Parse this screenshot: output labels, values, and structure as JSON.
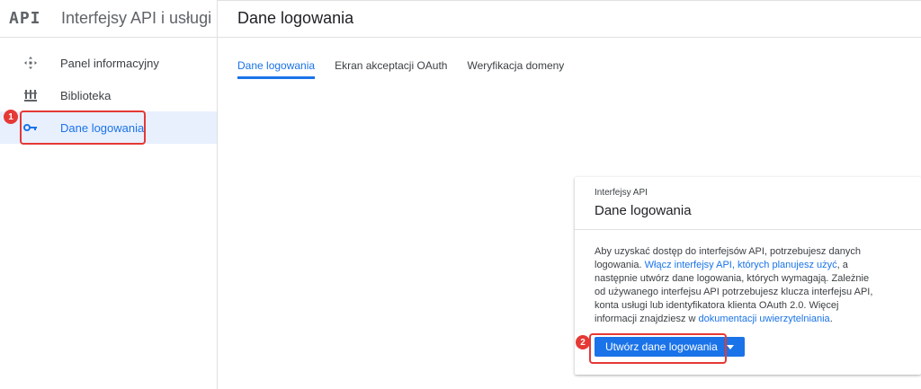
{
  "sidebar": {
    "logo": "API",
    "title": "Interfejsy API i usługi",
    "items": [
      {
        "label": "Panel informacyjny",
        "icon": "dashboard-icon"
      },
      {
        "label": "Biblioteka",
        "icon": "library-icon"
      },
      {
        "label": "Dane logowania",
        "icon": "key-icon",
        "active": true
      }
    ]
  },
  "annotations": {
    "step1": "1",
    "step2": "2",
    "highlight_color": "#e53935"
  },
  "main": {
    "title": "Dane logowania",
    "tabs": [
      {
        "label": "Dane logowania",
        "active": true
      },
      {
        "label": "Ekran akceptacji OAuth"
      },
      {
        "label": "Weryfikacja domeny"
      }
    ]
  },
  "card": {
    "overline": "Interfejsy API",
    "title": "Dane logowania",
    "text_1": "Aby uzyskać dostęp do interfejsów API, potrzebujesz danych logowania. ",
    "link_1": "Włącz interfejsy API, których planujesz użyć",
    "text_2": ", a następnie utwórz dane logowania, których wymagają. Zależnie od używanego interfejsu API potrzebujesz klucza interfejsu API, konta usługi lub identyfikatora klienta OAuth 2.0. Więcej informacji znajdziesz w ",
    "link_2": "dokumentacji uwierzytelniania",
    "text_3": ".",
    "button_label": "Utwórz dane logowania"
  },
  "colors": {
    "accent": "#1a73e8",
    "active_bg": "#e8f0fe"
  }
}
